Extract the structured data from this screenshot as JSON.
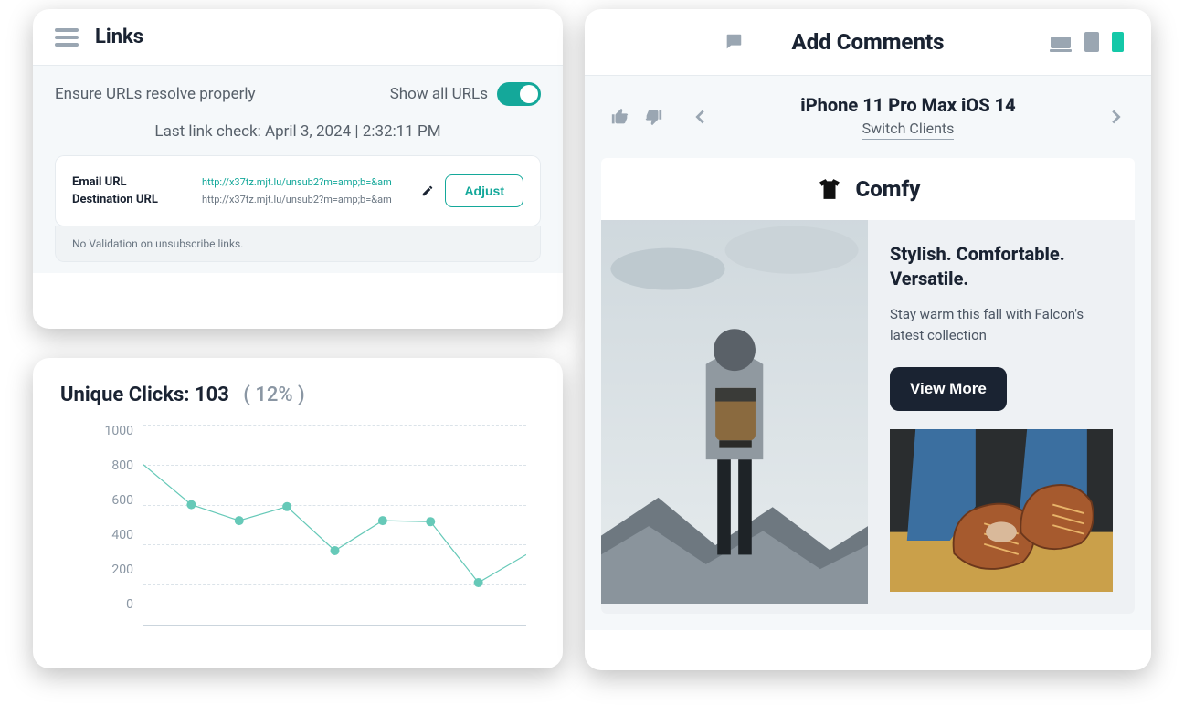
{
  "links": {
    "title": "Links",
    "ensure": "Ensure URLs resolve properly",
    "show_all": "Show all URLs",
    "last_check": "Last link check: April 3, 2024 | 2:32:11 PM",
    "email_label": "Email URL",
    "dest_label": "Destination URL",
    "email_url": "http://x37tz.mjt.lu/unsub2?m=amp;b=&am",
    "dest_url": "http://x37tz.mjt.lu/unsub2?m=amp;b=&am",
    "adjust": "Adjust",
    "no_validation": "No Validation on unsubscribe links."
  },
  "clicks": {
    "title": "Unique Clicks: 103",
    "pct": "(  12%  )"
  },
  "chart_data": {
    "type": "line",
    "title": "Unique Clicks: 103",
    "ylabel": "",
    "xlabel": "",
    "ylim": [
      0,
      1000
    ],
    "y_ticks": [
      0,
      200,
      400,
      600,
      800,
      1000
    ],
    "x": [
      0,
      1,
      2,
      3,
      4,
      5,
      6,
      7,
      8
    ],
    "values": [
      800,
      600,
      520,
      590,
      370,
      520,
      515,
      210,
      350
    ]
  },
  "comments": {
    "title": "Add Comments",
    "device": "iPhone 11 Pro Max iOS 14",
    "switch": "Switch Clients"
  },
  "preview": {
    "brand": "Comfy",
    "tagline": "Stylish. Comfortable. Versatile.",
    "desc": "Stay warm this fall with Falcon's latest collection",
    "cta": "View More"
  }
}
